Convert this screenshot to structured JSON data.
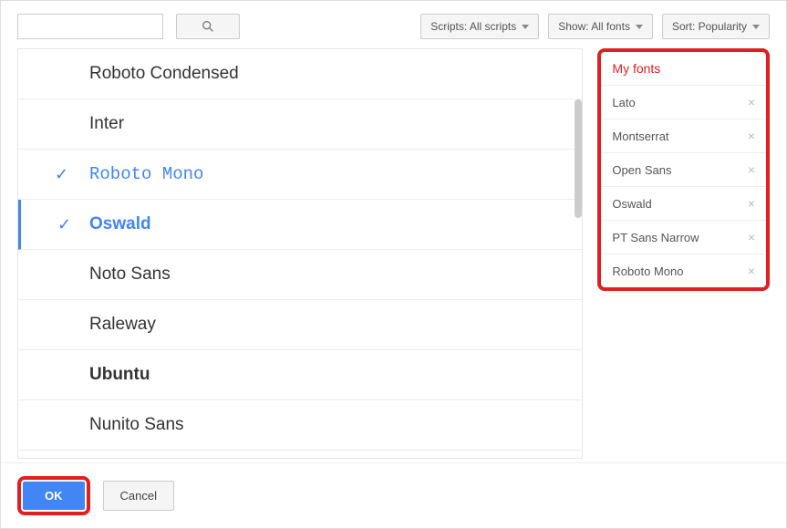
{
  "filters": {
    "scripts_label": "Scripts: All scripts",
    "show_label": "Show: All fonts",
    "sort_label": "Sort: Popularity"
  },
  "fonts": [
    {
      "name": "Roboto Condensed",
      "selected": false,
      "cls": "f-roboto-cond"
    },
    {
      "name": "Inter",
      "selected": false,
      "cls": "f-inter"
    },
    {
      "name": "Roboto Mono",
      "selected": true,
      "cls": "f-roboto-mono"
    },
    {
      "name": "Oswald",
      "selected": true,
      "cls": "f-oswald",
      "active": true
    },
    {
      "name": "Noto Sans",
      "selected": false,
      "cls": "f-noto"
    },
    {
      "name": "Raleway",
      "selected": false,
      "cls": "f-raleway"
    },
    {
      "name": "Ubuntu",
      "selected": false,
      "cls": "f-ubuntu"
    },
    {
      "name": "Nunito Sans",
      "selected": false,
      "cls": "f-nunito"
    }
  ],
  "my_fonts": {
    "title": "My fonts",
    "items": [
      {
        "name": "Lato"
      },
      {
        "name": "Montserrat"
      },
      {
        "name": "Open Sans"
      },
      {
        "name": "Oswald"
      },
      {
        "name": "PT Sans Narrow"
      },
      {
        "name": "Roboto Mono"
      }
    ]
  },
  "footer": {
    "ok_label": "OK",
    "cancel_label": "Cancel"
  }
}
